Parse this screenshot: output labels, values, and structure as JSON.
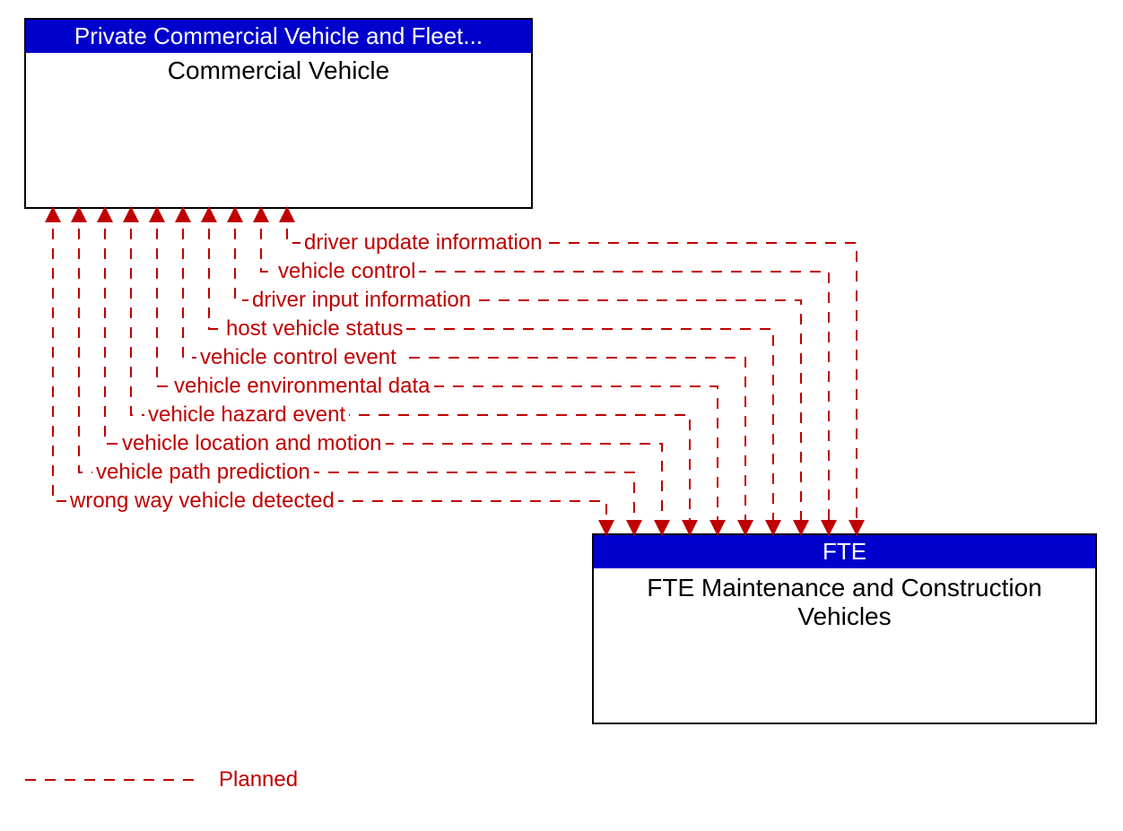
{
  "topBox": {
    "header": "Private Commercial Vehicle and Fleet...",
    "title": "Commercial Vehicle"
  },
  "bottomBox": {
    "header": "FTE",
    "title": "FTE Maintenance and Construction Vehicles"
  },
  "flows": [
    "driver update information",
    "vehicle control",
    "driver input information",
    "host vehicle status",
    "vehicle control event",
    "vehicle environmental data",
    "vehicle hazard event",
    "vehicle location and motion",
    "vehicle path prediction",
    "wrong way vehicle detected"
  ],
  "legend": {
    "planned": "Planned"
  },
  "colors": {
    "flow": "#c00000",
    "header": "#0000cc"
  }
}
